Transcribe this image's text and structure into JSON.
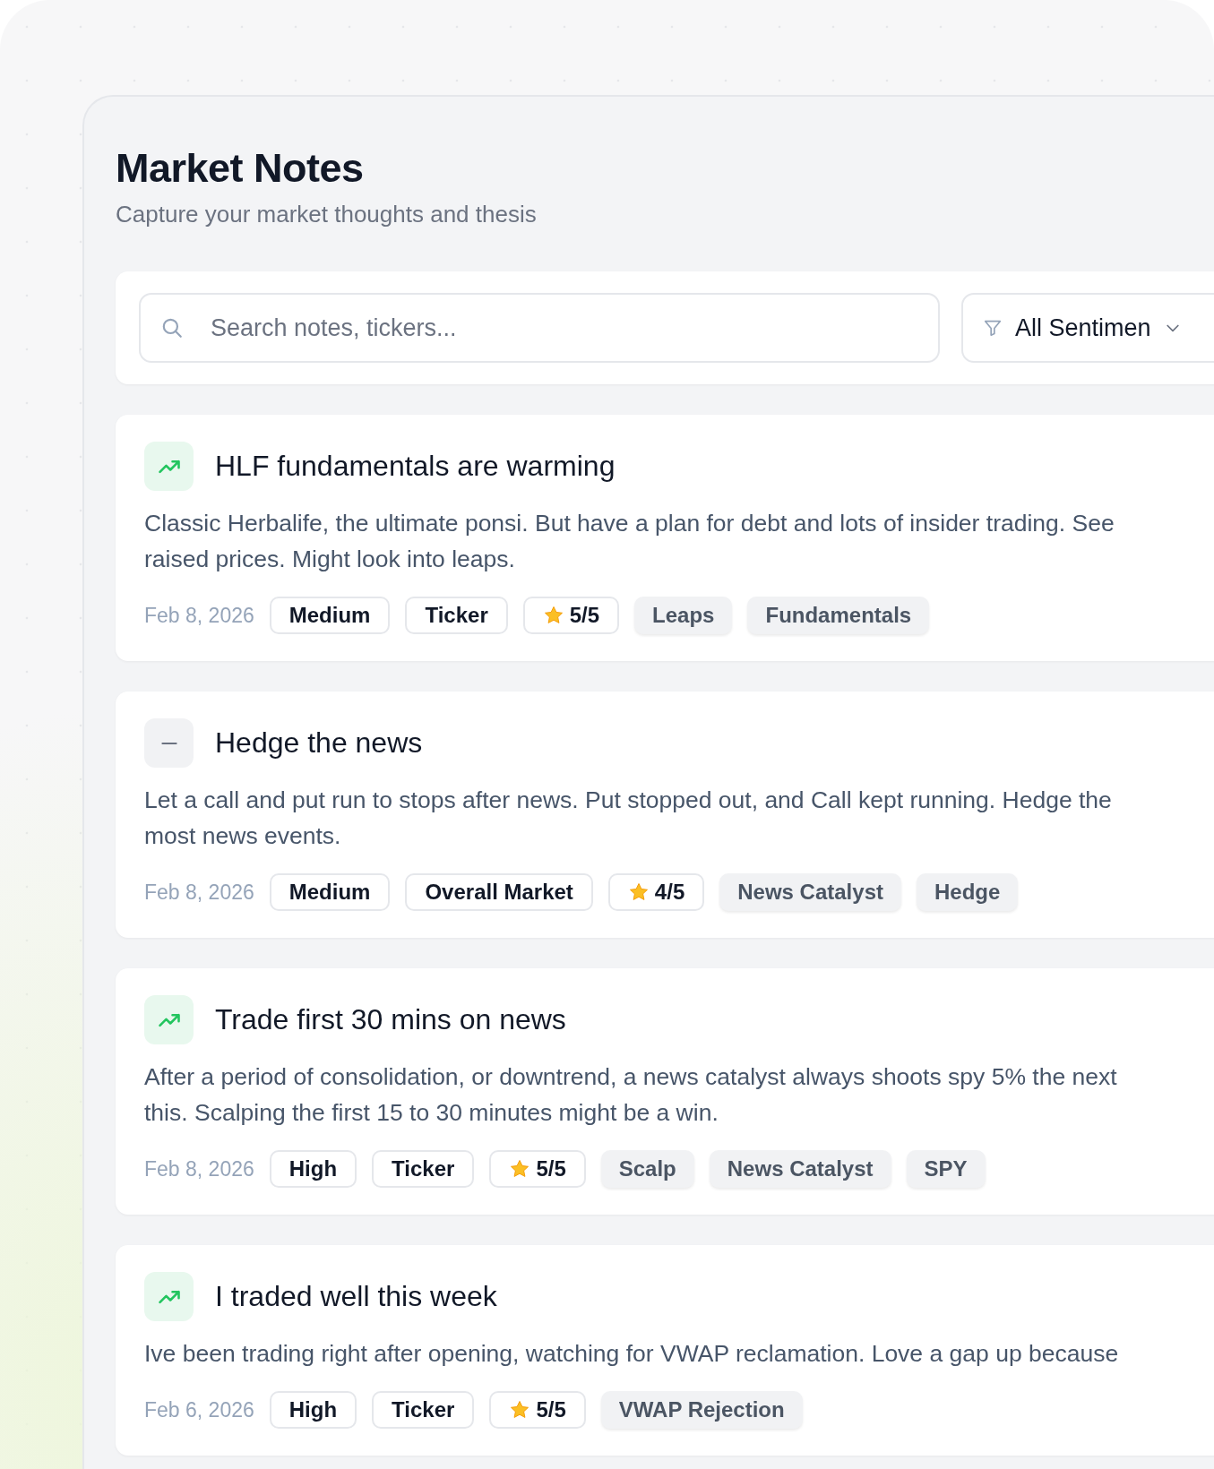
{
  "header": {
    "title": "Market Notes",
    "subtitle": "Capture your market thoughts and thesis"
  },
  "search": {
    "placeholder": "Search notes, tickers..."
  },
  "filter": {
    "value": "All Sentimen"
  },
  "notes": [
    {
      "kind": "bullish",
      "title": "HLF fundamentals are warming",
      "body_lines": [
        "Classic Herbalife, the ultimate ponsi. But have a plan for debt and lots of insider trading. See",
        "raised prices. Might look into leaps."
      ],
      "date": "Feb 8, 2026",
      "priority": "Medium",
      "category": "Ticker",
      "rating": "5/5",
      "tags": [
        "Leaps",
        "Fundamentals"
      ]
    },
    {
      "kind": "neutral",
      "title": "Hedge the news",
      "body_lines": [
        "Let a call and put run to stops after news. Put stopped out, and Call kept running. Hedge the",
        "most news events."
      ],
      "date": "Feb 8, 2026",
      "priority": "Medium",
      "category": "Overall Market",
      "rating": "4/5",
      "tags": [
        "News Catalyst",
        "Hedge"
      ]
    },
    {
      "kind": "bullish",
      "title": "Trade first 30 mins on news",
      "body_lines": [
        "After a period of consolidation, or downtrend, a news catalyst always shoots spy 5% the next",
        "this. Scalping the first 15 to 30 minutes might be a win."
      ],
      "date": "Feb 8, 2026",
      "priority": "High",
      "category": "Ticker",
      "rating": "5/5",
      "tags": [
        "Scalp",
        "News Catalyst",
        "SPY"
      ]
    },
    {
      "kind": "bullish",
      "title": "I traded well this week",
      "body_lines": [
        "Ive been trading right after opening, watching for VWAP reclamation. Love a gap up because"
      ],
      "date": "Feb 6, 2026",
      "priority": "High",
      "category": "Ticker",
      "rating": "5/5",
      "tags": [
        "VWAP Rejection"
      ]
    }
  ]
}
